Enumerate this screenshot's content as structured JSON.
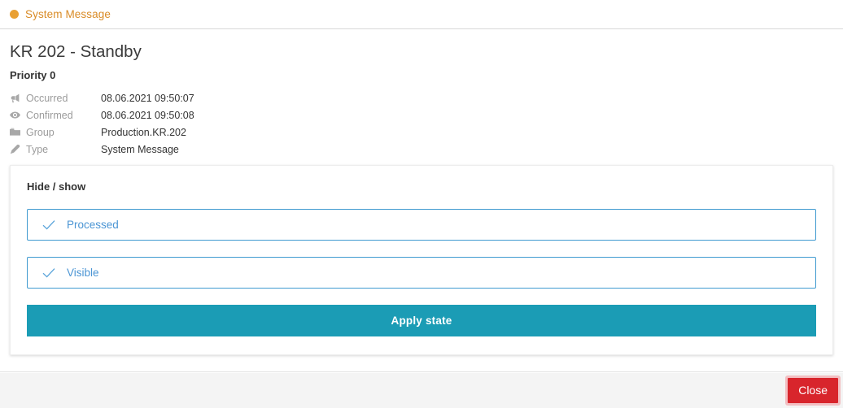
{
  "header": {
    "status_icon": "status-dot-icon",
    "status_color": "#e9a033",
    "title": "System Message"
  },
  "message": {
    "name": "KR 202",
    "separator": " - ",
    "state": "Standby",
    "priority_label": "Priority 0",
    "meta": [
      {
        "icon": "megaphone-icon",
        "label": "Occurred",
        "value": "08.06.2021 09:50:07"
      },
      {
        "icon": "eye-icon",
        "label": "Confirmed",
        "value": "08.06.2021 09:50:08"
      },
      {
        "icon": "folder-icon",
        "label": "Group",
        "value": "Production.KR.202"
      },
      {
        "icon": "tag-icon",
        "label": "Type",
        "value": "System Message"
      }
    ]
  },
  "card": {
    "heading": "Hide / show",
    "options": [
      {
        "label": "Processed",
        "icon": "check-icon",
        "checked": true
      },
      {
        "label": "Visible",
        "icon": "check-icon",
        "checked": true
      }
    ],
    "apply_label": "Apply state",
    "apply_color": "#1b9cb5",
    "option_color": "#4b95d4"
  },
  "footer": {
    "close_label": "Close",
    "close_color": "#d8252c"
  }
}
